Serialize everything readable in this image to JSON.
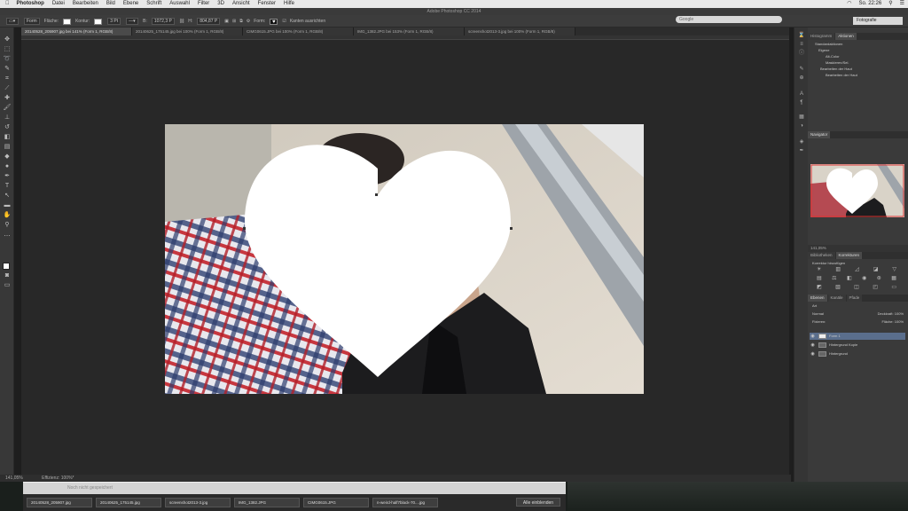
{
  "menubar": {
    "app": "Photoshop",
    "items": [
      "Datei",
      "Bearbeiten",
      "Bild",
      "Ebene",
      "Schrift",
      "Auswahl",
      "Filter",
      "3D",
      "Ansicht",
      "Fenster",
      "Hilfe"
    ],
    "clock": "So. 22:26"
  },
  "window_title": "Adobe Photoshop CC 2014",
  "options": {
    "shape_mode": "Form",
    "fill_label": "Fläche:",
    "stroke_label": "Kontur:",
    "stroke_width": "3 Pt",
    "width_label": "B:",
    "width_value": "1072,3 P",
    "height_label": "H:",
    "height_value": "804,87 P",
    "shape_label": "Form:",
    "align_edges": "Kanten ausrichten"
  },
  "search_placeholder": "Google",
  "workspace": "Fotografie",
  "tabs": [
    "20140528_205907.jpg bei 141% (Form 1, RGB/8)",
    "20140625_175145.jpg bei 100% (Form 1, RGB/8)",
    "CIMG0615.JPG bei 100% (Form 1, RGB/8)",
    "IMG_1382.JPG bei 153% (Form 1, RGB/8)",
    "screenshot2013-3.jpg bei 100% (Form 1, RGB/8)"
  ],
  "status": {
    "zoom": "141,05%",
    "doc": "Effizienz: 100%*"
  },
  "panels": {
    "top_tabs": [
      "Histogramm",
      "Aktionen"
    ],
    "actions": [
      "Standardaktionen",
      "Eigene",
      "Alt-Color",
      "Maskieren/Sel.",
      "Bearbeiten der Haut",
      "Bearbeiten der Haut"
    ],
    "navigator_tab": "Navigator",
    "navigator_zoom": "141,05%",
    "adj_tabs": [
      "Bibliotheken",
      "Korrekturen"
    ],
    "adj_title": "Korrektur hinzufügen",
    "layers_tabs": [
      "Ebenen",
      "Kanäle",
      "Pfade"
    ],
    "layers_filter": "Art",
    "blend_mode": "Normal",
    "opacity_label": "Deckkraft:",
    "opacity": "100%",
    "lock_label": "Fixieren:",
    "fill_label": "Fläche:",
    "fill": "100%",
    "layers": [
      "Form 1",
      "Hintergrund Kopie",
      "Hintergrund"
    ]
  },
  "dock": {
    "status_hint": "Noch nicht gespeichert",
    "downloads": [
      "20140528_205907.jpg",
      "20140625_175145.jpg",
      "screenshot2013-3.jpg",
      "IMG_1382.JPG",
      "CIMG0615.JPG",
      "n-weird-half7black-70....jpg"
    ],
    "show_all": "Alle einblenden"
  }
}
